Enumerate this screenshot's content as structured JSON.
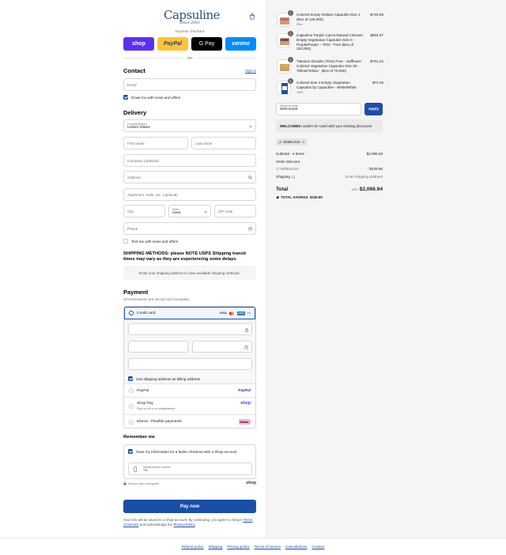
{
  "brand": {
    "name": "Capsuline",
    "since": "Since 2003"
  },
  "express": {
    "label": "Express checkout",
    "buttons": [
      "shop",
      "PayPal",
      "G Pay",
      "venmo"
    ],
    "or": "OR"
  },
  "contact": {
    "title": "Contact",
    "sign_in": "Sign in",
    "email_placeholder": "Email",
    "news_label": "Email me with news and offers"
  },
  "delivery": {
    "title": "Delivery",
    "country_label": "Country/Region",
    "country_value": "United States",
    "first_name": "First name",
    "last_name": "Last name",
    "company": "Company (optional)",
    "address": "Address",
    "apartment": "Apartment, suite, etc. (optional)",
    "city": "City",
    "state_label": "State",
    "state_value": "Iowa",
    "zip": "ZIP code",
    "phone": "Phone",
    "text_label": "Text me with news and offers"
  },
  "shipping": {
    "note": "SHIPPING METHODS: please NOTE USPS Shipping transit times may vary as they are experiencing some delays.",
    "placeholder": "Enter your shipping address to view available shipping methods."
  },
  "payment": {
    "title": "Payment",
    "subtitle": "All transactions are secure and encrypted.",
    "credit_card": "Credit card",
    "card_brands": [
      "VISA",
      "MC",
      "AMEX"
    ],
    "more": "+1",
    "billing_same": "Use shipping address as billing address",
    "paypal": "PayPal",
    "paypal_logo": "PayPal",
    "shop_pay": "Shop Pay",
    "shop_pay_sub": "Pay in full or in installments",
    "shop_logo": "shop",
    "klarna": "Klarna - Flexible payments",
    "klarna_logo": "Klarna."
  },
  "remember": {
    "title": "Remember me",
    "save_label": "Save my information for a faster checkout with a Shop account",
    "phone_label": "Mobile phone number",
    "phone_value": "+1",
    "secure": "Secure and encrypted",
    "shop": "shop"
  },
  "pay_now": "Pay now",
  "legal": {
    "text1": "Your info will be saved to a Shop account. By continuing, you agree to Shop's",
    "terms": "Terms of Service",
    "text2": "and acknowledge the",
    "privacy": "Privacy Policy"
  },
  "order": {
    "items": [
      {
        "qty": "1",
        "name": "Colored Empty Gelatin Capsules Size 1 (Box of 125,000)",
        "variant": "Pink",
        "price": "$716.99",
        "color": "#d4607a"
      },
      {
        "qty": "1",
        "name": "Capsuline Purple Carrot Natural Colorant Empty Vegetarian Capsules Size 0 - Purple/Purple – TiO2 - Free (Box of 100,000)",
        "variant": "",
        "price": "$604.87",
        "color": "#7a3a7a"
      },
      {
        "qty": "1",
        "name": "Titanium Dioxide (TiO2) Free - Safflower Colored Vegetarian Capsules Size 00 - Yellow/Yellow - (Box of 75,000)",
        "variant": "",
        "price": "$701.24",
        "color": "#e0b030"
      },
      {
        "qty": "1",
        "name": "Colored Size 4 Empty Vegetarian Capsules by Capsuline - White/White",
        "variant": "1000",
        "price": "$73.49",
        "color": "#1f4fa0"
      }
    ],
    "discount_label": "Discount code",
    "discount_value": "Welcome5",
    "apply": "Apply",
    "warn_bold": "WELCOME5",
    "warn_rest": "couldn't be used with your existing discounts.",
    "tag": "MOBILE10",
    "subtotal_label": "Subtotal · 4 items",
    "subtotal": "$2,096.59",
    "order_discount": "Order discount",
    "discount_code": "MOBILE10",
    "discount_amount": "- $229.65",
    "shipping_label": "Shipping",
    "shipping_value": "Enter shipping address",
    "total_label": "Total",
    "currency": "USD",
    "total": "$2,066.94",
    "savings_label": "TOTAL SAVINGS",
    "savings": "$229.65"
  },
  "footer": [
    "Refund policy",
    "Shipping",
    "Privacy policy",
    "Terms of service",
    "Cancellations",
    "Contact"
  ]
}
